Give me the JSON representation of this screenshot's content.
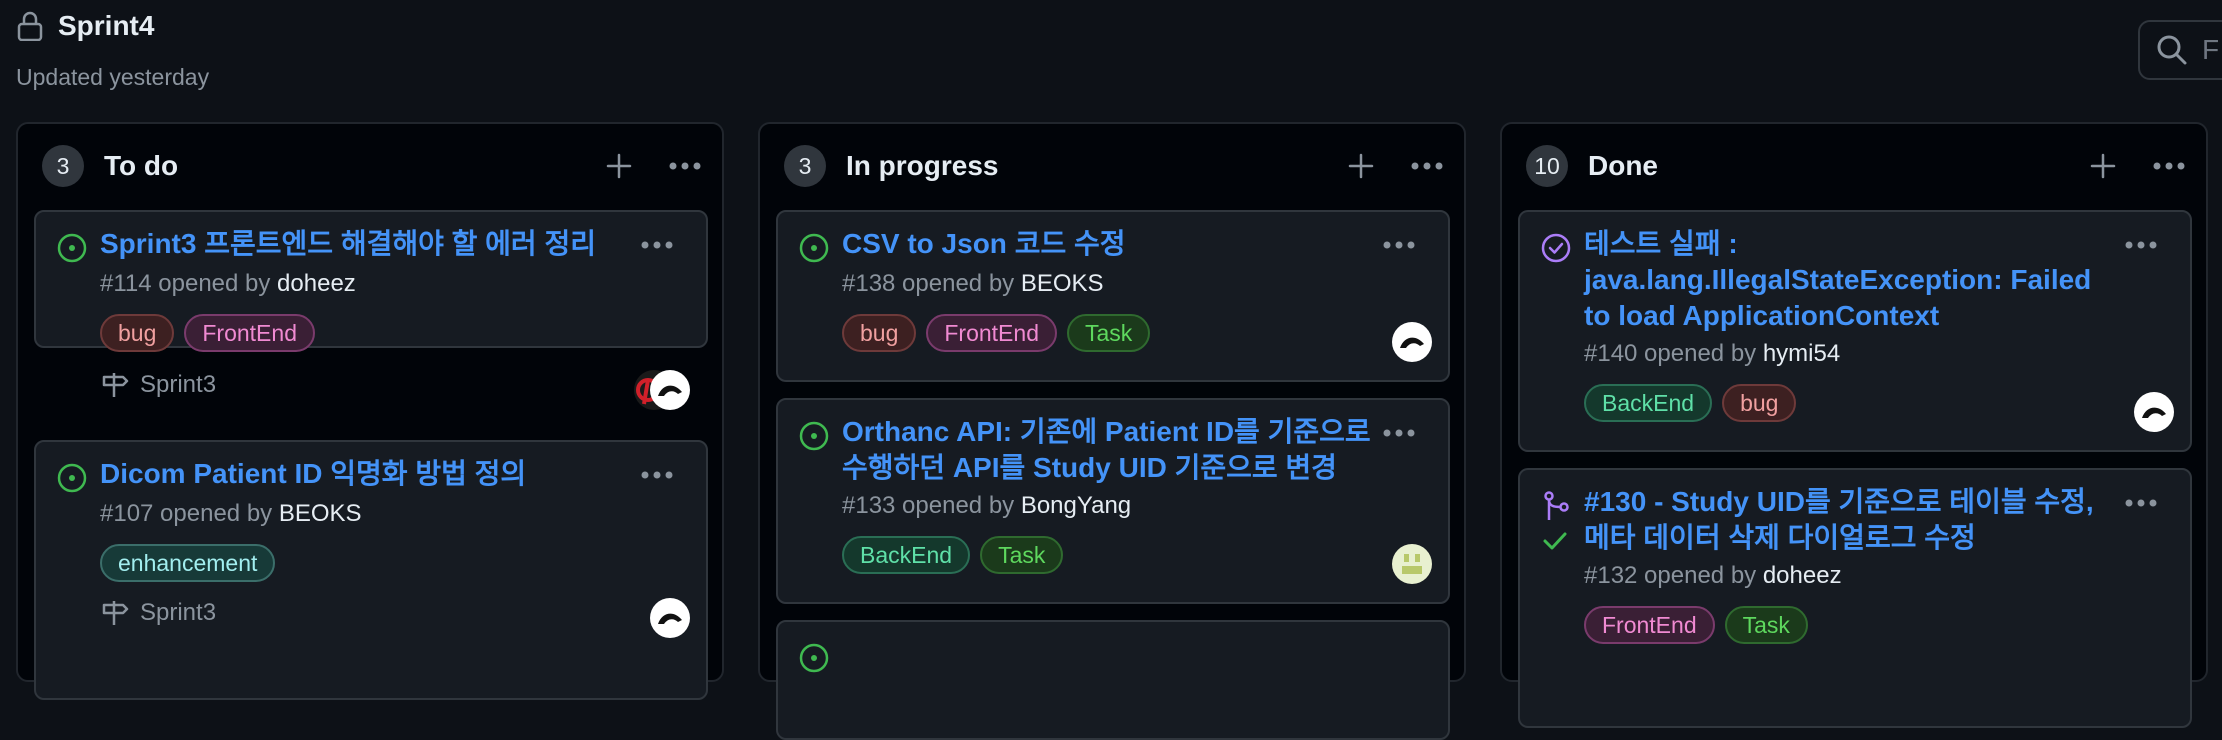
{
  "header": {
    "title": "Sprint4",
    "subtitle": "Updated yesterday"
  },
  "search": {
    "placeholder": "F"
  },
  "columns": [
    {
      "count": "3",
      "name": "To do",
      "cards": [
        {
          "title": "Sprint3 프론트엔드 해결해야 할 에러 정리",
          "number": "#114",
          "opened_by": " opened by ",
          "user": "doheez",
          "labels": [
            "bug",
            "FrontEnd"
          ],
          "milestone": "Sprint3"
        },
        {
          "title": "Dicom Patient ID 익명화 방법 정의",
          "number": "#107",
          "opened_by": " opened by ",
          "user": "BEOKS",
          "labels": [
            "enhancement"
          ],
          "milestone": "Sprint3"
        }
      ]
    },
    {
      "count": "3",
      "name": "In progress",
      "cards": [
        {
          "title": "CSV to Json 코드 수정",
          "number": "#138",
          "opened_by": " opened by ",
          "user": "BEOKS",
          "labels": [
            "bug",
            "FrontEnd",
            "Task"
          ]
        },
        {
          "title": "Orthanc API: 기존에 Patient ID를 기준으로 수행하던 API를 Study UID 기준으로 변경",
          "number": "#133",
          "opened_by": " opened by ",
          "user": "BongYang",
          "labels": [
            "BackEnd",
            "Task"
          ]
        }
      ]
    },
    {
      "count": "10",
      "name": "Done",
      "cards": [
        {
          "title": "테스트 실패 : java.lang.IllegalStateException: Failed to load ApplicationContext",
          "number": "#140",
          "opened_by": " opened by ",
          "user": "hymi54",
          "labels": [
            "BackEnd",
            "bug"
          ]
        },
        {
          "title": "#130 - Study UID를 기준으로 테이블 수정, 메타 데이터 삭제 다이얼로그 수정",
          "number": "#132",
          "opened_by": " opened by ",
          "user": "doheez",
          "labels": [
            "FrontEnd",
            "Task"
          ]
        }
      ]
    }
  ],
  "colors": {
    "background": "#0d1117",
    "link": "#4493f8",
    "open": "#3fb950",
    "done": "#ab7df8"
  }
}
